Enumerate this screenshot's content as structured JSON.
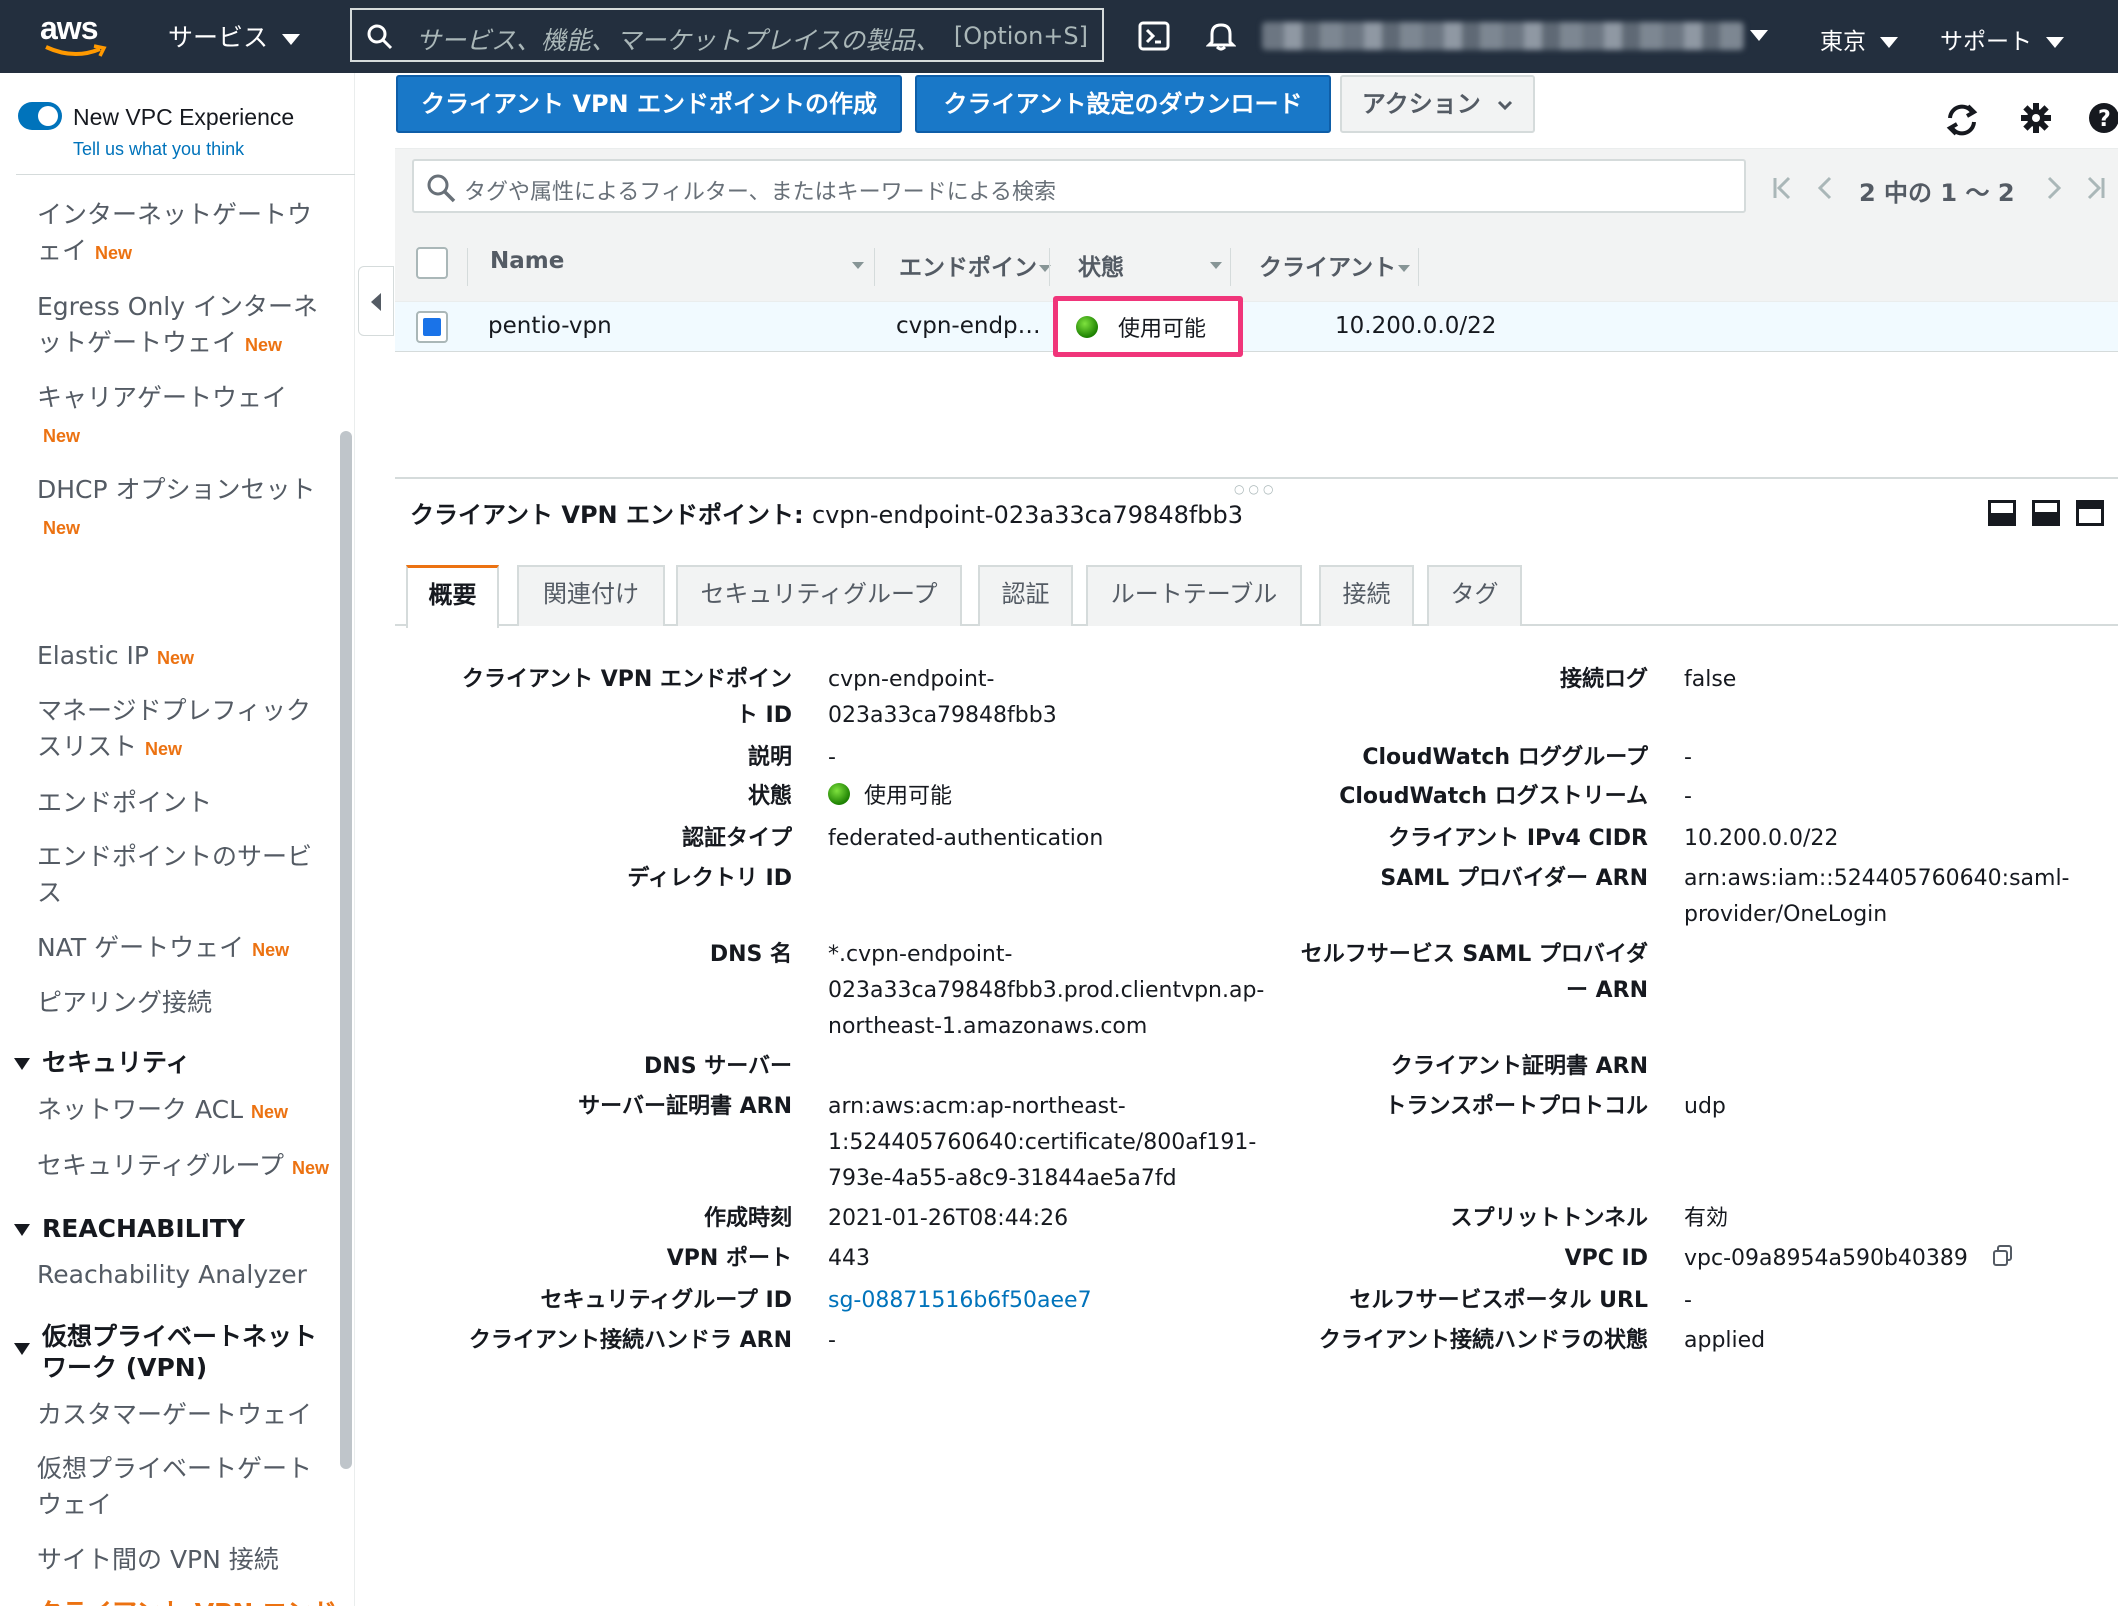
{
  "topnav": {
    "services_label": "サービス",
    "search_placeholder": "サービス、機能、マーケットプレイスの製品、",
    "search_shortcut": "[Option+S]",
    "region_label": "東京",
    "support_label": "サポート"
  },
  "sidebar": {
    "experience_label": "New VPC Experience",
    "experience_link": "Tell us what you think",
    "new_badge": "New",
    "items": {
      "igw": "インターネットゲートウェイ",
      "egress": "Egress Only インターネットゲートウェイ",
      "carrier": "キャリアゲートウェイ",
      "dhcp": "DHCP オプションセット",
      "eip": "Elastic IP",
      "prefix": "マネージドプレフィックスリスト",
      "endpoints": "エンドポイント",
      "endpoint_services": "エンドポイントのサービス",
      "nat": "NAT ゲートウェイ",
      "peering": "ピアリング接続",
      "nacl": "ネットワーク ACL",
      "sg": "セキュリティグループ",
      "reach_analyzer": "Reachability Analyzer",
      "cgw": "カスタマーゲートウェイ",
      "vgw": "仮想プライベートゲートウェイ",
      "s2s": "サイト間の VPN 接続",
      "cvpn": "クライアント VPN エンドポイント"
    },
    "sections": {
      "security": "セキュリティ",
      "reachability": "REACHABILITY",
      "vpn": "仮想プライベートネットワーク (VPN)"
    }
  },
  "toolbar": {
    "create_label": "クライアント VPN エンドポイントの作成",
    "download_label": "クライアント設定のダウンロード",
    "actions_label": "アクション"
  },
  "filter": {
    "placeholder": "タグや属性によるフィルター、またはキーワードによる検索",
    "pager_text": "2 中の 1 〜 2"
  },
  "grid": {
    "headers": {
      "name": "Name",
      "endpoint": "エンドポイン",
      "state": "状態",
      "client": "クライアント"
    },
    "row": {
      "name": "pentio-vpn",
      "endpoint": "cvpn-endp…",
      "state": "使用可能",
      "client": "10.200.0.0/22"
    }
  },
  "detail": {
    "title_prefix": "クライアント VPN エンドポイント:",
    "title_id": "cvpn-endpoint-023a33ca79848fbb3",
    "tabs": [
      "概要",
      "関連付け",
      "セキュリティグループ",
      "認証",
      "ルートテーブル",
      "接続",
      "タグ"
    ],
    "left": {
      "endpoint_id_label": "クライアント VPN エンドポイン\nト ID",
      "endpoint_id_value": "cvpn-endpoint-\n023a33ca79848fbb3",
      "description_label": "説明",
      "description_value": "-",
      "state_label": "状態",
      "state_value": "使用可能",
      "auth_type_label": "認証タイプ",
      "auth_type_value": "federated-authentication",
      "directory_label": "ディレクトリ ID",
      "dns_name_label": "DNS 名",
      "dns_name_value": "*.cvpn-endpoint-\n023a33ca79848fbb3.prod.clientvpn.ap-\nnortheast-1.amazonaws.com",
      "dns_server_label": "DNS サーバー",
      "server_cert_label": "サーバー証明書 ARN",
      "server_cert_value": "arn:aws:acm:ap-northeast-\n1:524405760640:certificate/800af191-\n793e-4a55-a8c9-31844ae5a7fd",
      "created_label": "作成時刻",
      "created_value": "2021-01-26T08:44:26",
      "vpn_port_label": "VPN ポート",
      "vpn_port_value": "443",
      "sg_id_label": "セキュリティグループ ID",
      "sg_id_value": "sg-08871516b6f50aee7",
      "handler_arn_label": "クライアント接続ハンドラ ARN",
      "handler_arn_value": "-"
    },
    "right": {
      "conn_log_label": "接続ログ",
      "conn_log_value": "false",
      "cw_group_label": "CloudWatch ロググループ",
      "cw_group_value": "-",
      "cw_stream_label": "CloudWatch ログストリーム",
      "cw_stream_value": "-",
      "client_cidr_label": "クライアント IPv4 CIDR",
      "client_cidr_value": "10.200.0.0/22",
      "saml_label": "SAML プロバイダー ARN",
      "saml_value": "arn:aws:iam::524405760640:saml-\nprovider/OneLogin",
      "self_saml_label": "セルフサービス SAML プロバイダ\nー ARN",
      "client_cert_label": "クライアント証明書 ARN",
      "transport_label": "トランスポートプロトコル",
      "transport_value": "udp",
      "split_label": "スプリットトンネル",
      "split_value": "有効",
      "vpc_id_label": "VPC ID",
      "vpc_id_value": "vpc-09a8954a590b40389",
      "portal_label": "セルフサービスポータル URL",
      "portal_value": "-",
      "handler_state_label": "クライアント接続ハンドラの状態",
      "handler_state_value": "applied"
    }
  },
  "colors": {
    "nav_bg": "#232f3e",
    "primary": "#1978c8",
    "accent": "#ec7211",
    "highlight": "#f0357a",
    "link": "#0073bb"
  }
}
